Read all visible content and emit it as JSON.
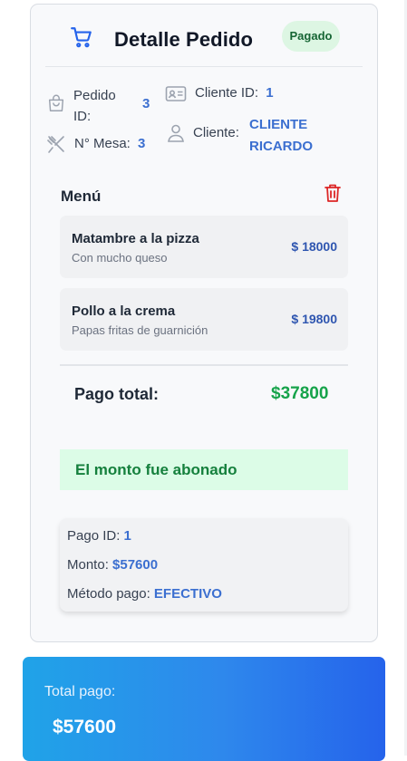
{
  "header": {
    "title": "Detalle Pedido",
    "status_badge": "Pagado"
  },
  "order_info": {
    "pedido_label_line1": "Pedido",
    "pedido_label_line2": "ID:",
    "pedido_id": "3",
    "mesa_label": "N° Mesa:",
    "mesa_value": "3",
    "cliente_id_label": "Cliente ID:",
    "cliente_id_value": "1",
    "cliente_label": "Cliente:",
    "cliente_name_line1": "CLIENTE",
    "cliente_name_line2": "RICARDO"
  },
  "menu": {
    "title": "Menú",
    "items": [
      {
        "name": "Matambre a la pizza",
        "description": "Con mucho queso",
        "price": "$ 18000"
      },
      {
        "name": "Pollo a la crema",
        "description": "Papas fritas de guarnición",
        "price": "$ 19800"
      }
    ]
  },
  "total": {
    "label": "Pago total:",
    "value": "$37800"
  },
  "paid_message": "El monto fue abonado",
  "payment": {
    "id_label": "Pago ID:",
    "id_value": "1",
    "monto_label": "Monto:",
    "monto_value": "$57600",
    "metodo_label": "Método pago:",
    "metodo_value": "EFECTIVO"
  },
  "summary": {
    "label": "Total pago:",
    "amount": "$57600"
  },
  "icons": [
    "cart-icon",
    "bag-icon",
    "id-card-icon",
    "utensils-icon",
    "user-icon",
    "trash-icon"
  ],
  "colors": {
    "accent_blue": "#3b6fd0",
    "success_green": "#16a34a",
    "badge_bg": "#ddf6e3",
    "danger_red": "#dc2626",
    "summary_gradient_start": "#20a3e8",
    "summary_gradient_end": "#2563eb"
  }
}
